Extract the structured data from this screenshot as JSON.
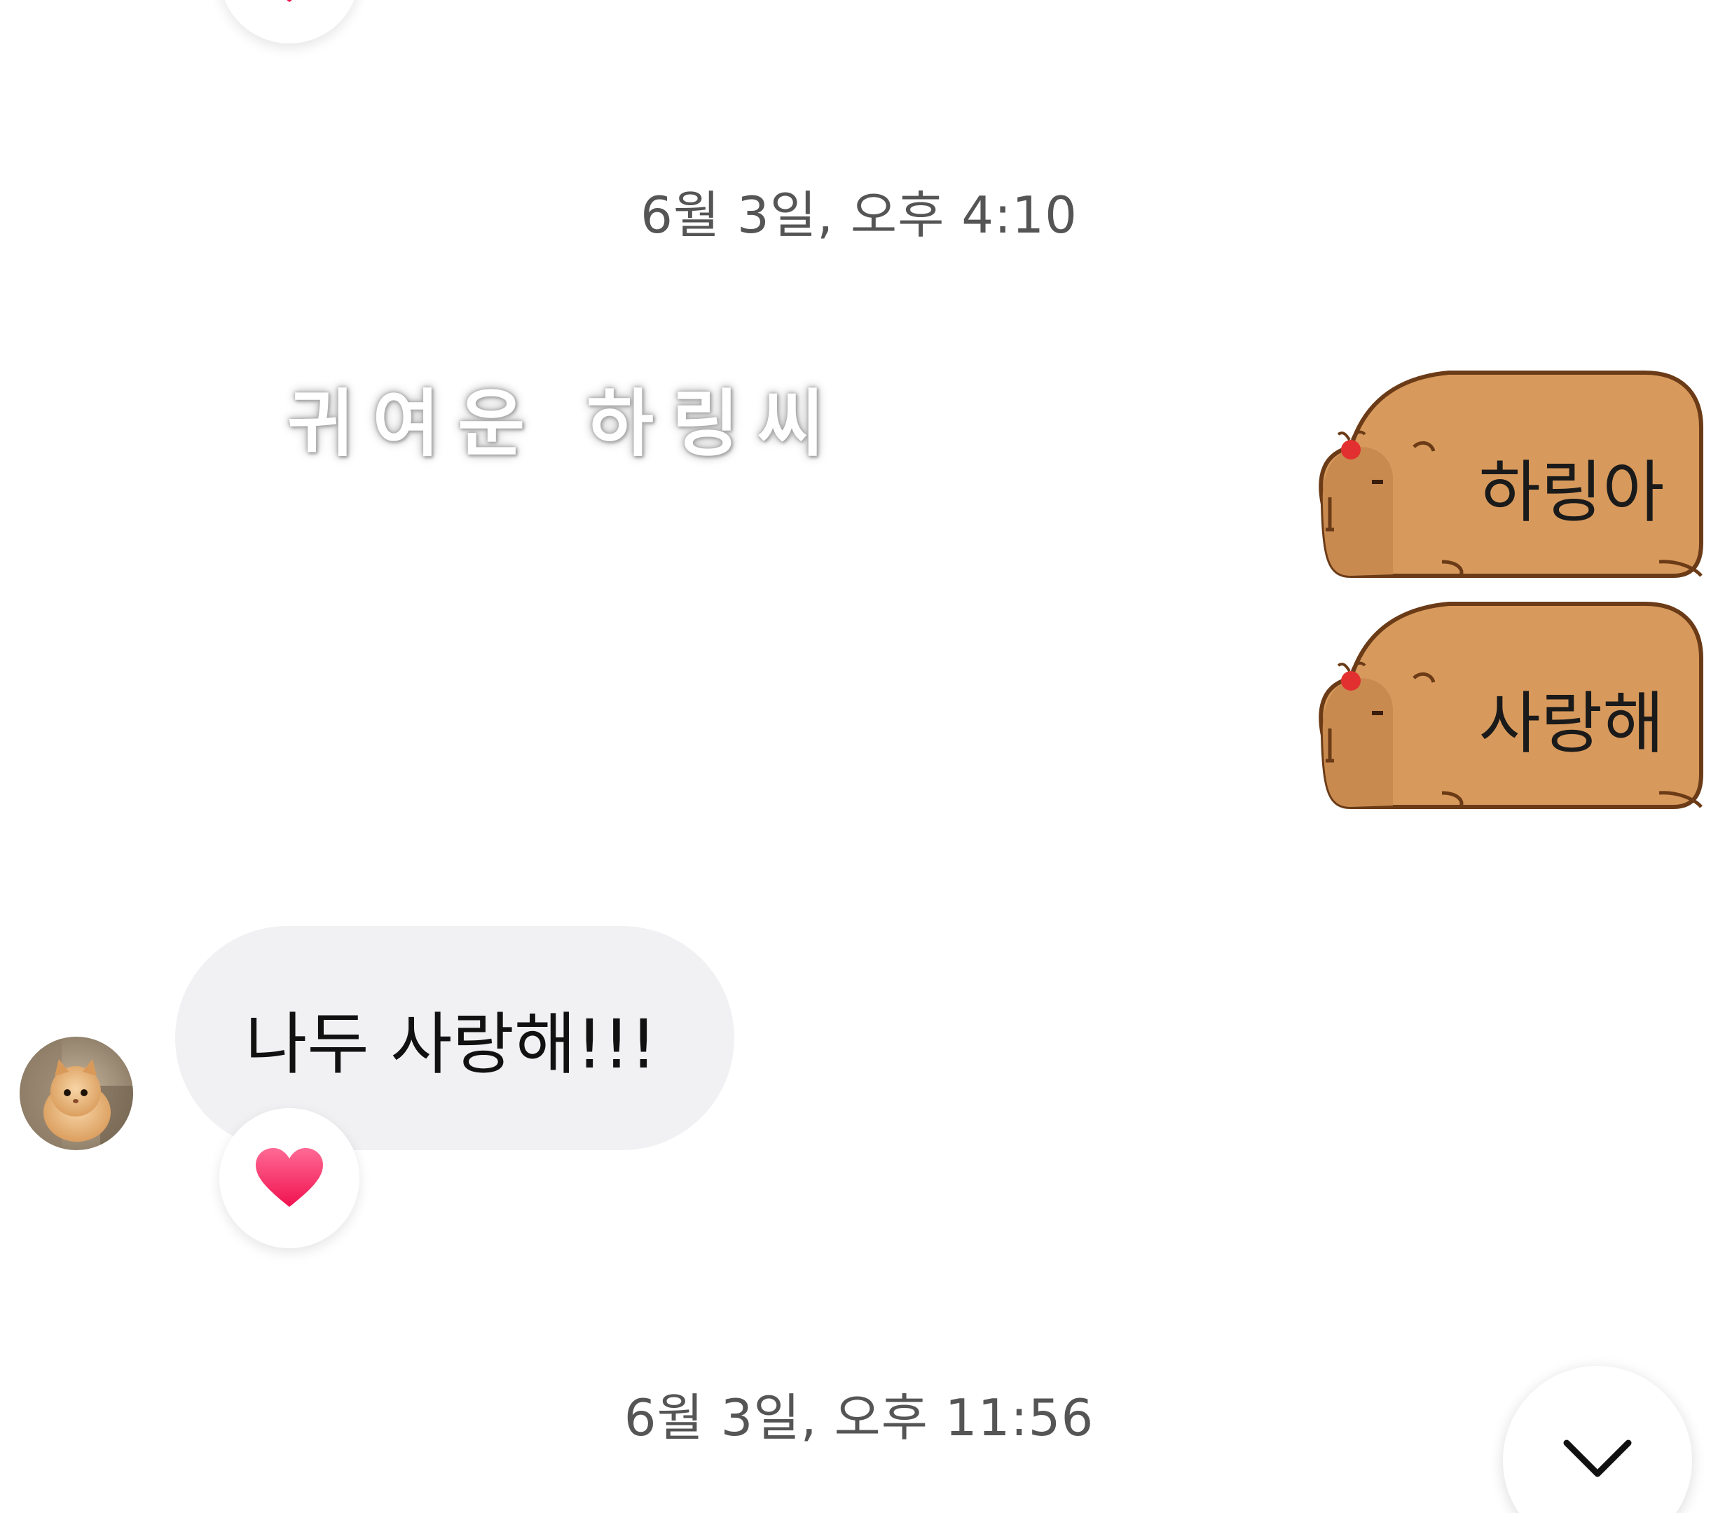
{
  "timestamps": {
    "first": "6월 3일, 오후 4:10",
    "second": "6월 3일, 오후 11:56"
  },
  "messages": {
    "handwritten_sticker": "귀여운 하링씨",
    "sticker_1": "하링아",
    "sticker_2": "사랑해",
    "incoming_text": "나두 사랑해!!!"
  },
  "reactions": {
    "emoji": "heart-icon",
    "color": "#ff2d6b"
  },
  "colors": {
    "bubble_bg": "#f1f1f3",
    "capybara_fill": "#d89a5c",
    "capybara_outline": "#6b3b17",
    "timestamp_text": "#555555"
  },
  "icons": {
    "scroll_down": "chevron-down-icon",
    "avatar": "kitten-avatar"
  }
}
